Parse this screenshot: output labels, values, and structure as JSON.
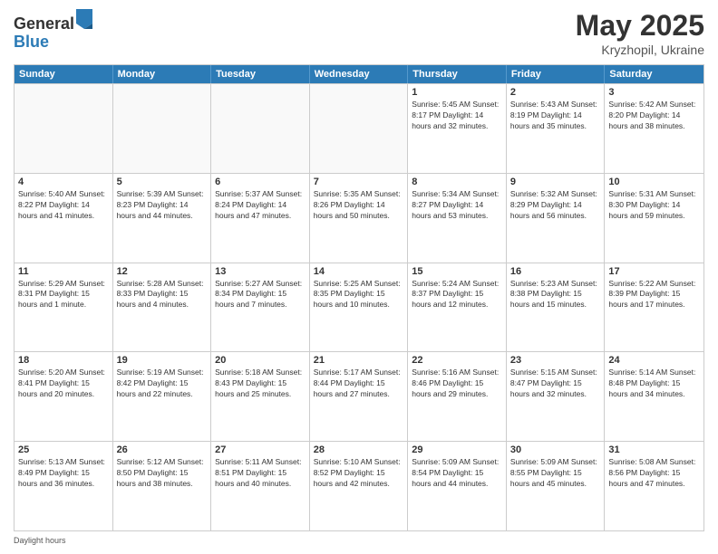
{
  "header": {
    "logo_general": "General",
    "logo_blue": "Blue",
    "title": "May 2025",
    "subtitle": "Kryzhopil, Ukraine"
  },
  "days_of_week": [
    "Sunday",
    "Monday",
    "Tuesday",
    "Wednesday",
    "Thursday",
    "Friday",
    "Saturday"
  ],
  "weeks": [
    [
      {
        "day": "",
        "info": "",
        "empty": true
      },
      {
        "day": "",
        "info": "",
        "empty": true
      },
      {
        "day": "",
        "info": "",
        "empty": true
      },
      {
        "day": "",
        "info": "",
        "empty": true
      },
      {
        "day": "1",
        "info": "Sunrise: 5:45 AM\nSunset: 8:17 PM\nDaylight: 14 hours\nand 32 minutes.",
        "empty": false
      },
      {
        "day": "2",
        "info": "Sunrise: 5:43 AM\nSunset: 8:19 PM\nDaylight: 14 hours\nand 35 minutes.",
        "empty": false
      },
      {
        "day": "3",
        "info": "Sunrise: 5:42 AM\nSunset: 8:20 PM\nDaylight: 14 hours\nand 38 minutes.",
        "empty": false
      }
    ],
    [
      {
        "day": "4",
        "info": "Sunrise: 5:40 AM\nSunset: 8:22 PM\nDaylight: 14 hours\nand 41 minutes.",
        "empty": false
      },
      {
        "day": "5",
        "info": "Sunrise: 5:39 AM\nSunset: 8:23 PM\nDaylight: 14 hours\nand 44 minutes.",
        "empty": false
      },
      {
        "day": "6",
        "info": "Sunrise: 5:37 AM\nSunset: 8:24 PM\nDaylight: 14 hours\nand 47 minutes.",
        "empty": false
      },
      {
        "day": "7",
        "info": "Sunrise: 5:35 AM\nSunset: 8:26 PM\nDaylight: 14 hours\nand 50 minutes.",
        "empty": false
      },
      {
        "day": "8",
        "info": "Sunrise: 5:34 AM\nSunset: 8:27 PM\nDaylight: 14 hours\nand 53 minutes.",
        "empty": false
      },
      {
        "day": "9",
        "info": "Sunrise: 5:32 AM\nSunset: 8:29 PM\nDaylight: 14 hours\nand 56 minutes.",
        "empty": false
      },
      {
        "day": "10",
        "info": "Sunrise: 5:31 AM\nSunset: 8:30 PM\nDaylight: 14 hours\nand 59 minutes.",
        "empty": false
      }
    ],
    [
      {
        "day": "11",
        "info": "Sunrise: 5:29 AM\nSunset: 8:31 PM\nDaylight: 15 hours\nand 1 minute.",
        "empty": false
      },
      {
        "day": "12",
        "info": "Sunrise: 5:28 AM\nSunset: 8:33 PM\nDaylight: 15 hours\nand 4 minutes.",
        "empty": false
      },
      {
        "day": "13",
        "info": "Sunrise: 5:27 AM\nSunset: 8:34 PM\nDaylight: 15 hours\nand 7 minutes.",
        "empty": false
      },
      {
        "day": "14",
        "info": "Sunrise: 5:25 AM\nSunset: 8:35 PM\nDaylight: 15 hours\nand 10 minutes.",
        "empty": false
      },
      {
        "day": "15",
        "info": "Sunrise: 5:24 AM\nSunset: 8:37 PM\nDaylight: 15 hours\nand 12 minutes.",
        "empty": false
      },
      {
        "day": "16",
        "info": "Sunrise: 5:23 AM\nSunset: 8:38 PM\nDaylight: 15 hours\nand 15 minutes.",
        "empty": false
      },
      {
        "day": "17",
        "info": "Sunrise: 5:22 AM\nSunset: 8:39 PM\nDaylight: 15 hours\nand 17 minutes.",
        "empty": false
      }
    ],
    [
      {
        "day": "18",
        "info": "Sunrise: 5:20 AM\nSunset: 8:41 PM\nDaylight: 15 hours\nand 20 minutes.",
        "empty": false
      },
      {
        "day": "19",
        "info": "Sunrise: 5:19 AM\nSunset: 8:42 PM\nDaylight: 15 hours\nand 22 minutes.",
        "empty": false
      },
      {
        "day": "20",
        "info": "Sunrise: 5:18 AM\nSunset: 8:43 PM\nDaylight: 15 hours\nand 25 minutes.",
        "empty": false
      },
      {
        "day": "21",
        "info": "Sunrise: 5:17 AM\nSunset: 8:44 PM\nDaylight: 15 hours\nand 27 minutes.",
        "empty": false
      },
      {
        "day": "22",
        "info": "Sunrise: 5:16 AM\nSunset: 8:46 PM\nDaylight: 15 hours\nand 29 minutes.",
        "empty": false
      },
      {
        "day": "23",
        "info": "Sunrise: 5:15 AM\nSunset: 8:47 PM\nDaylight: 15 hours\nand 32 minutes.",
        "empty": false
      },
      {
        "day": "24",
        "info": "Sunrise: 5:14 AM\nSunset: 8:48 PM\nDaylight: 15 hours\nand 34 minutes.",
        "empty": false
      }
    ],
    [
      {
        "day": "25",
        "info": "Sunrise: 5:13 AM\nSunset: 8:49 PM\nDaylight: 15 hours\nand 36 minutes.",
        "empty": false
      },
      {
        "day": "26",
        "info": "Sunrise: 5:12 AM\nSunset: 8:50 PM\nDaylight: 15 hours\nand 38 minutes.",
        "empty": false
      },
      {
        "day": "27",
        "info": "Sunrise: 5:11 AM\nSunset: 8:51 PM\nDaylight: 15 hours\nand 40 minutes.",
        "empty": false
      },
      {
        "day": "28",
        "info": "Sunrise: 5:10 AM\nSunset: 8:52 PM\nDaylight: 15 hours\nand 42 minutes.",
        "empty": false
      },
      {
        "day": "29",
        "info": "Sunrise: 5:09 AM\nSunset: 8:54 PM\nDaylight: 15 hours\nand 44 minutes.",
        "empty": false
      },
      {
        "day": "30",
        "info": "Sunrise: 5:09 AM\nSunset: 8:55 PM\nDaylight: 15 hours\nand 45 minutes.",
        "empty": false
      },
      {
        "day": "31",
        "info": "Sunrise: 5:08 AM\nSunset: 8:56 PM\nDaylight: 15 hours\nand 47 minutes.",
        "empty": false
      }
    ]
  ],
  "footer": {
    "daylight_label": "Daylight hours"
  }
}
